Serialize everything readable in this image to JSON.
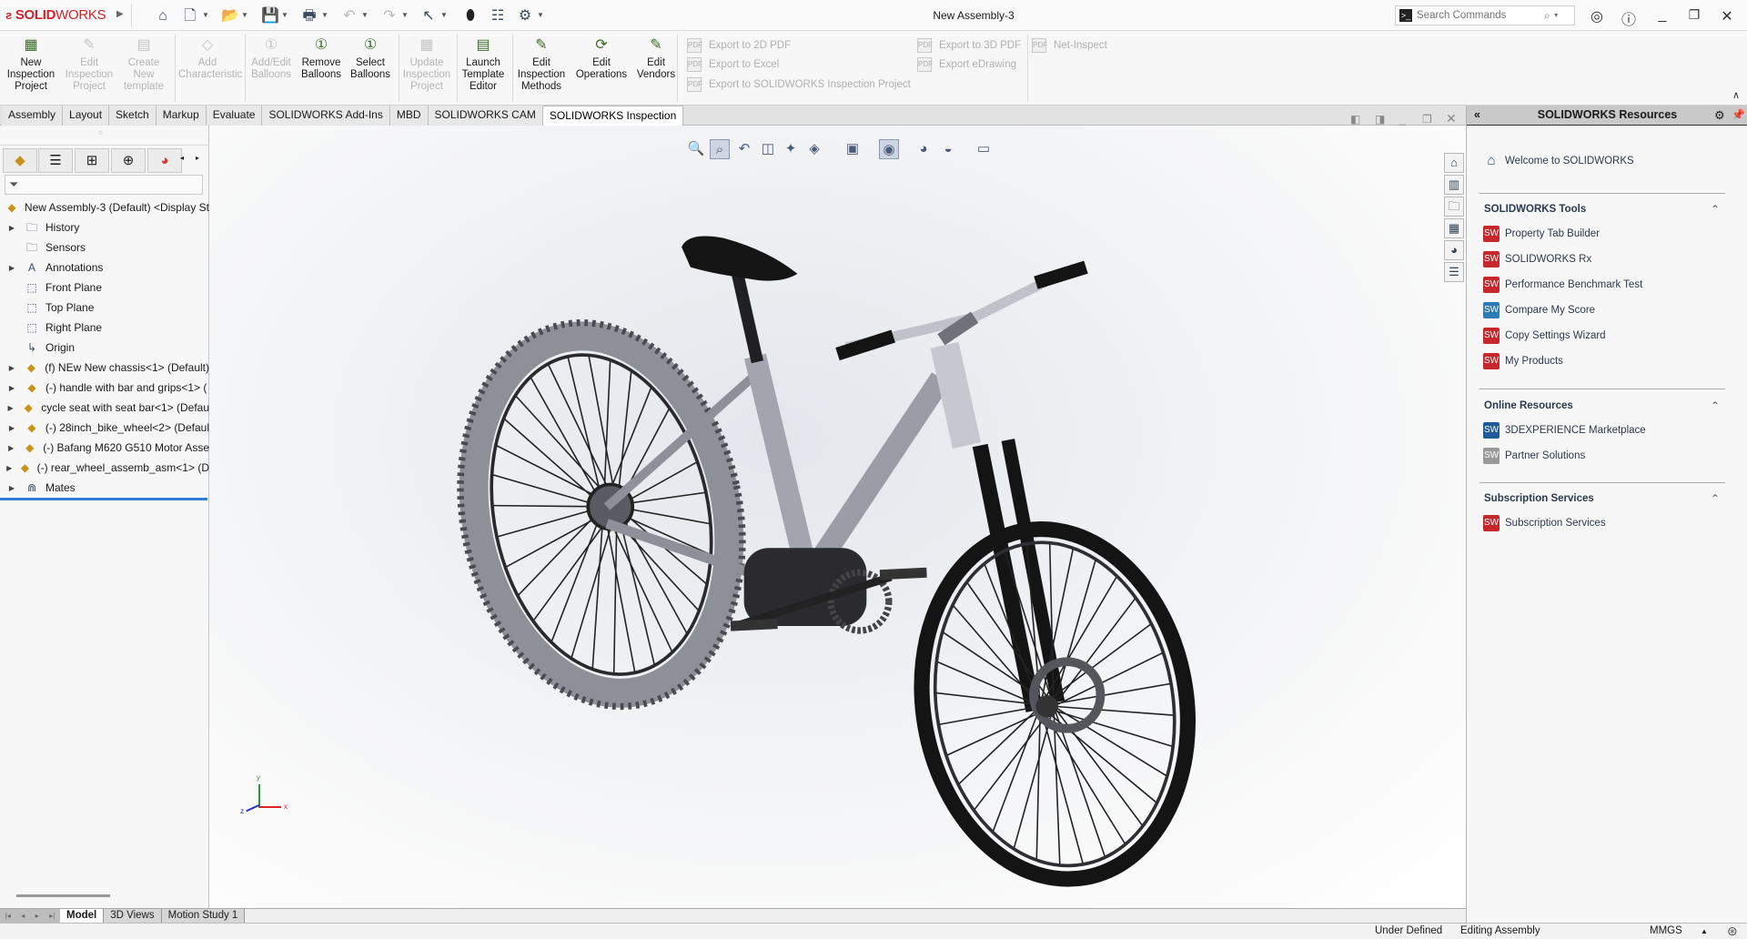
{
  "app": {
    "brand": "SOLIDWORKS",
    "brand_bold": "SOLID",
    "brand_light": "WORKS",
    "document_title": "New Assembly-3"
  },
  "quick_access": [
    "home-icon",
    "new-document-icon",
    "open-icon",
    "save-icon",
    "print-icon",
    "undo-icon",
    "redo-icon",
    "select-icon",
    "rebuild-traffic-light-icon",
    "file-properties-icon",
    "options-gear-icon"
  ],
  "search": {
    "placeholder": "Search Commands"
  },
  "ribbon": {
    "buttons": [
      {
        "label": "New\nInspection\nProject",
        "enabled": true
      },
      {
        "label": "Edit\nInspection\nProject",
        "enabled": false
      },
      {
        "label": "Create\nNew\ntemplate",
        "enabled": false
      },
      {
        "label": "Add\nCharacteristic",
        "enabled": false
      },
      {
        "label": "Add/Edit\nBalloons",
        "enabled": false
      },
      {
        "label": "Remove\nBalloons",
        "enabled": true
      },
      {
        "label": "Select\nBalloons",
        "enabled": true
      },
      {
        "label": "Update\nInspection\nProject",
        "enabled": false
      },
      {
        "label": "Launch\nTemplate\nEditor",
        "enabled": true
      },
      {
        "label": "Edit\nInspection\nMethods",
        "enabled": true
      },
      {
        "label": "Edit\nOperations",
        "enabled": true
      },
      {
        "label": "Edit\nVendors",
        "enabled": true
      }
    ],
    "exports": [
      "Export to 2D PDF",
      "Export to Excel",
      "Export to SOLIDWORKS Inspection Project",
      "Export to 3D PDF",
      "Export eDrawing",
      "Net-Inspect"
    ]
  },
  "tabs": [
    {
      "label": "Assembly"
    },
    {
      "label": "Layout"
    },
    {
      "label": "Sketch"
    },
    {
      "label": "Markup"
    },
    {
      "label": "Evaluate"
    },
    {
      "label": "SOLIDWORKS Add-Ins"
    },
    {
      "label": "MBD"
    },
    {
      "label": "SOLIDWORKS CAM"
    },
    {
      "label": "SOLIDWORKS Inspection",
      "active": true
    }
  ],
  "feature_tree": {
    "root": "New Assembly-3 (Default) <Display St",
    "items": [
      {
        "label": "History",
        "icon": "history-folder-icon",
        "expandable": true
      },
      {
        "label": "Sensors",
        "icon": "sensors-folder-icon",
        "expandable": false
      },
      {
        "label": "Annotations",
        "icon": "annotations-folder-icon",
        "expandable": true
      },
      {
        "label": "Front Plane",
        "icon": "plane-icon",
        "expandable": false
      },
      {
        "label": "Top Plane",
        "icon": "plane-icon",
        "expandable": false
      },
      {
        "label": "Right Plane",
        "icon": "plane-icon",
        "expandable": false
      },
      {
        "label": "Origin",
        "icon": "origin-icon",
        "expandable": false
      },
      {
        "label": "(f) NEw New chassis<1> (Default)",
        "icon": "subassembly-icon",
        "expandable": true
      },
      {
        "label": "(-) handle with bar and grips<1> (",
        "icon": "subassembly-icon",
        "expandable": true
      },
      {
        "label": "cycle seat with seat bar<1> (Defau",
        "icon": "subassembly-icon",
        "expandable": true
      },
      {
        "label": "(-) 28inch_bike_wheel<2> (Defaul",
        "icon": "subassembly-icon",
        "expandable": true
      },
      {
        "label": "(-) Bafang M620 G510 Motor Asse",
        "icon": "subassembly-icon",
        "expandable": true
      },
      {
        "label": "(-) rear_wheel_assemb_asm<1> (D",
        "icon": "subassembly-icon",
        "expandable": true
      },
      {
        "label": "Mates",
        "icon": "mates-icon",
        "expandable": true
      }
    ]
  },
  "triad": {
    "x": "x",
    "y": "y",
    "z": "z"
  },
  "resources": {
    "title": "SOLIDWORKS Resources",
    "welcome": "Welcome to SOLIDWORKS",
    "sections": [
      {
        "title": "SOLIDWORKS Tools",
        "items": [
          "Property Tab Builder",
          "SOLIDWORKS Rx",
          "Performance Benchmark Test",
          "Compare My Score",
          "Copy Settings Wizard",
          "My Products"
        ]
      },
      {
        "title": "Online Resources",
        "items": [
          "3DEXPERIENCE Marketplace",
          "Partner Solutions"
        ]
      },
      {
        "title": "Subscription Services",
        "items": [
          "Subscription Services"
        ]
      }
    ]
  },
  "bottom_tabs": [
    {
      "label": "Model",
      "active": true
    },
    {
      "label": "3D Views"
    },
    {
      "label": "Motion Study 1"
    }
  ],
  "status": {
    "state": "Under Defined",
    "mode": "Editing Assembly",
    "units": "MMGS"
  },
  "colors": {
    "brand": "#d2232a",
    "frame": "#9a9ca6",
    "tire_black": "#141414"
  }
}
